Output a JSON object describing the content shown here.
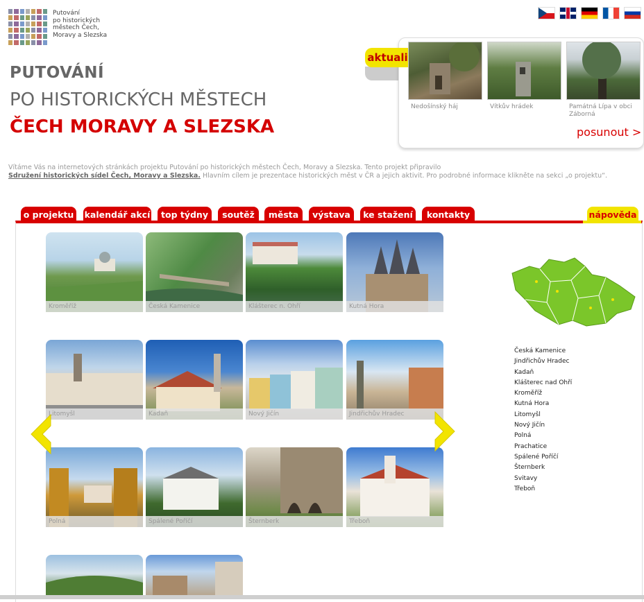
{
  "logo": {
    "lines": [
      "Putování",
      "po historických",
      "městech Čech,",
      "Moravy a Slezska"
    ]
  },
  "flags": [
    {
      "name": "cz-flag-icon",
      "cls": "flag-cz"
    },
    {
      "name": "gb-flag-icon",
      "cls": "flag-gb"
    },
    {
      "name": "de-flag-icon",
      "cls": "flag-de"
    },
    {
      "name": "fr-flag-icon",
      "cls": "flag-fr"
    },
    {
      "name": "ru-flag-icon",
      "cls": "flag-ru"
    }
  ],
  "title": {
    "line1": "PUTOVÁNÍ",
    "line2": "PO HISTORICKÝCH MĚSTECH",
    "line3": "ČECH MORAVY A SLEZSKA"
  },
  "news": {
    "tab_label": "aktuality",
    "items": [
      {
        "caption": "Nedošínský háj"
      },
      {
        "caption": "Vítkův hrádek"
      },
      {
        "caption": "Památná Lípa v obci Záborná"
      }
    ],
    "more_label": "posunout >"
  },
  "intro": {
    "line1": "Vítáme Vás na internetových stránkách projektu Putování po historických městech Čech, Moravy a Slezska. Tento projekt připravilo",
    "link": "Sdružení historických sídel Čech, Moravy a Slezska.",
    "line2": " Hlavním cílem je prezentace historických měst v ČR a jejich aktivit. Pro podrobné informace klikněte na sekci „o projektu“."
  },
  "menu": {
    "tabs": [
      "o projektu",
      "kalendář akcí",
      "top týdny",
      "soutěž",
      "města",
      "výstava",
      "ke stažení",
      "kontakty"
    ],
    "help": "nápověda"
  },
  "towns": [
    "Kroměříž",
    "Česká Kamenice",
    "Klášterec n. Ohří",
    "Kutná Hora",
    "Litomyšl",
    "Kadaň",
    "Nový Jičín",
    "Jindřichův Hradec",
    "Polná",
    "Spálené Poříčí",
    "Šternberk",
    "Třeboň"
  ],
  "town_list": [
    "Česká Kamenice",
    "Jindřichův Hradec",
    "Kadaň",
    "Klášterec nad Ohří",
    "Kroměříž",
    "Kutná Hora",
    "Litomyšl",
    "Nový Jičín",
    "Polná",
    "Prachatice",
    "Spálené Poříčí",
    "Šternberk",
    "Svitavy",
    "Třeboň"
  ],
  "colors": {
    "accent_red": "#d80000",
    "accent_yellow": "#f2e400",
    "map_green": "#7bc62a"
  }
}
